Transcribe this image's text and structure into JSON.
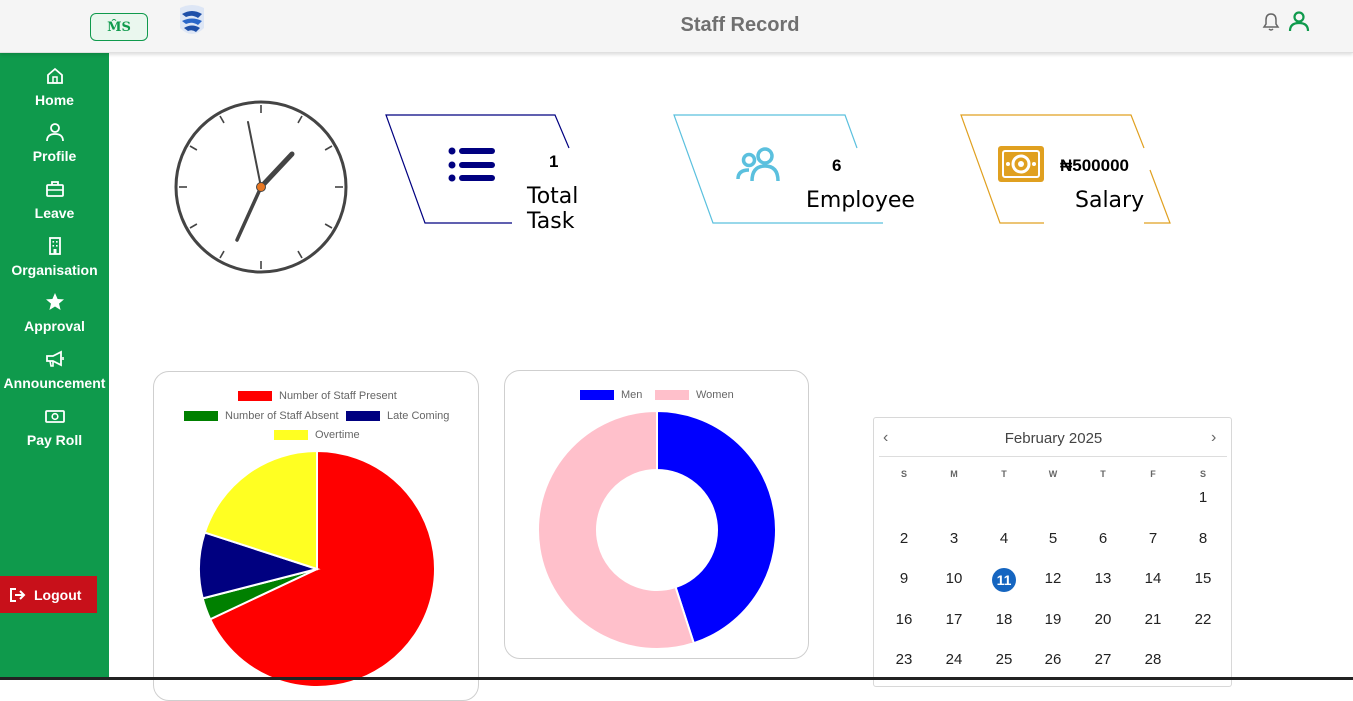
{
  "header": {
    "logo_text": "M̂S",
    "title": "Staff Record"
  },
  "sidebar": {
    "items": [
      {
        "label": "Home",
        "icon": "home-icon"
      },
      {
        "label": "Profile",
        "icon": "user-icon"
      },
      {
        "label": "Leave",
        "icon": "briefcase-icon"
      },
      {
        "label": "Organisation",
        "icon": "building-icon"
      },
      {
        "label": "Approval",
        "icon": "star-icon"
      },
      {
        "label": "Announcement",
        "icon": "megaphone-icon"
      },
      {
        "label": "Pay Roll",
        "icon": "money-icon"
      }
    ],
    "logout_label": "Logout"
  },
  "stats": {
    "task": {
      "value": "1",
      "label": "Total Task",
      "color": "#000080"
    },
    "employee": {
      "value": "6",
      "label": "Employee",
      "color": "#5bc0de"
    },
    "salary": {
      "value": "₦500000",
      "label": "Salary",
      "color": "#e0a020"
    }
  },
  "chart_data": [
    {
      "type": "pie",
      "series": [
        {
          "name": "Number of Staff Present",
          "value": 68,
          "color": "#ff0000"
        },
        {
          "name": "Number of Staff Absent",
          "value": 3,
          "color": "#008000"
        },
        {
          "name": "Late Coming",
          "value": 9,
          "color": "#000080"
        },
        {
          "name": "Overtime",
          "value": 20,
          "color": "#ffff22"
        }
      ],
      "legend_position": "top"
    },
    {
      "type": "pie",
      "series": [
        {
          "name": "Men",
          "value": 45,
          "color": "#0000ff"
        },
        {
          "name": "Women",
          "value": 55,
          "color": "#ffc0cb"
        }
      ],
      "legend_position": "top"
    }
  ],
  "calendar": {
    "month_label": "February 2025",
    "weekdays": [
      "S",
      "M",
      "T",
      "W",
      "T",
      "F",
      "S"
    ],
    "first_weekday_index": 6,
    "days_in_month": 28,
    "selected_day": 11,
    "prev_icon": "chevron-left-icon",
    "next_icon": "chevron-right-icon",
    "selected_color": "#1565c0"
  },
  "colors": {
    "sidebar_bg": "#0f9a4c",
    "logout_bg": "#c8101a"
  }
}
